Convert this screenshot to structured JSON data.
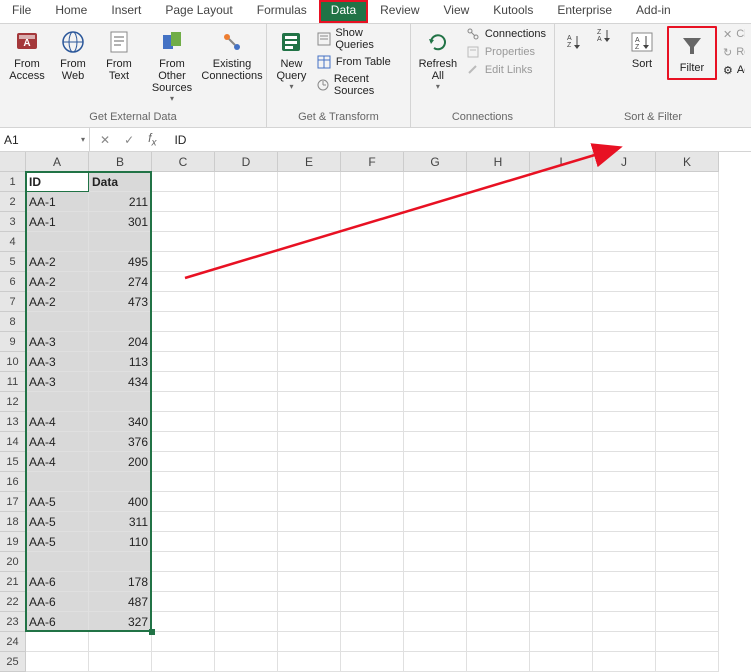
{
  "tabs": {
    "items": [
      "File",
      "Home",
      "Insert",
      "Page Layout",
      "Formulas",
      "Data",
      "Review",
      "View",
      "Kutools",
      "Enterprise",
      "Add-in"
    ],
    "active": "Data"
  },
  "ribbon": {
    "get_external": {
      "title": "Get External Data",
      "from_access": "From\nAccess",
      "from_web": "From\nWeb",
      "from_text": "From\nText",
      "from_other": "From Other\nSources",
      "existing": "Existing\nConnections"
    },
    "get_transform": {
      "title": "Get & Transform",
      "new_query": "New\nQuery",
      "show_queries": "Show Queries",
      "from_table": "From Table",
      "recent": "Recent Sources"
    },
    "connections": {
      "title": "Connections",
      "refresh": "Refresh\nAll",
      "conns": "Connections",
      "props": "Properties",
      "edit_links": "Edit Links"
    },
    "sort_filter": {
      "title": "Sort & Filter",
      "sort": "Sort",
      "filter": "Filter",
      "clear": "Cle",
      "reapply": "Rea",
      "advanced": "Ad"
    }
  },
  "formula_bar": {
    "name": "A1",
    "value": "ID"
  },
  "columns": [
    "A",
    "B",
    "C",
    "D",
    "E",
    "F",
    "G",
    "H",
    "I",
    "J",
    "K"
  ],
  "rows": 25,
  "selection": {
    "c1": 0,
    "r1": 0,
    "c2": 1,
    "r2": 22
  },
  "cells": [
    {
      "r": 0,
      "c": 0,
      "v": "ID",
      "bold": true
    },
    {
      "r": 0,
      "c": 1,
      "v": "Data",
      "bold": true
    },
    {
      "r": 1,
      "c": 0,
      "v": "AA-1"
    },
    {
      "r": 1,
      "c": 1,
      "v": "211",
      "num": true
    },
    {
      "r": 2,
      "c": 0,
      "v": "AA-1"
    },
    {
      "r": 2,
      "c": 1,
      "v": "301",
      "num": true
    },
    {
      "r": 4,
      "c": 0,
      "v": "AA-2"
    },
    {
      "r": 4,
      "c": 1,
      "v": "495",
      "num": true
    },
    {
      "r": 5,
      "c": 0,
      "v": "AA-2"
    },
    {
      "r": 5,
      "c": 1,
      "v": "274",
      "num": true
    },
    {
      "r": 6,
      "c": 0,
      "v": "AA-2"
    },
    {
      "r": 6,
      "c": 1,
      "v": "473",
      "num": true
    },
    {
      "r": 8,
      "c": 0,
      "v": "AA-3"
    },
    {
      "r": 8,
      "c": 1,
      "v": "204",
      "num": true
    },
    {
      "r": 9,
      "c": 0,
      "v": "AA-3"
    },
    {
      "r": 9,
      "c": 1,
      "v": "113",
      "num": true
    },
    {
      "r": 10,
      "c": 0,
      "v": "AA-3"
    },
    {
      "r": 10,
      "c": 1,
      "v": "434",
      "num": true
    },
    {
      "r": 12,
      "c": 0,
      "v": "AA-4"
    },
    {
      "r": 12,
      "c": 1,
      "v": "340",
      "num": true
    },
    {
      "r": 13,
      "c": 0,
      "v": "AA-4"
    },
    {
      "r": 13,
      "c": 1,
      "v": "376",
      "num": true
    },
    {
      "r": 14,
      "c": 0,
      "v": "AA-4"
    },
    {
      "r": 14,
      "c": 1,
      "v": "200",
      "num": true
    },
    {
      "r": 16,
      "c": 0,
      "v": "AA-5"
    },
    {
      "r": 16,
      "c": 1,
      "v": "400",
      "num": true
    },
    {
      "r": 17,
      "c": 0,
      "v": "AA-5"
    },
    {
      "r": 17,
      "c": 1,
      "v": "311",
      "num": true
    },
    {
      "r": 18,
      "c": 0,
      "v": "AA-5"
    },
    {
      "r": 18,
      "c": 1,
      "v": "110",
      "num": true
    },
    {
      "r": 20,
      "c": 0,
      "v": "AA-6"
    },
    {
      "r": 20,
      "c": 1,
      "v": "178",
      "num": true
    },
    {
      "r": 21,
      "c": 0,
      "v": "AA-6"
    },
    {
      "r": 21,
      "c": 1,
      "v": "487",
      "num": true
    },
    {
      "r": 22,
      "c": 0,
      "v": "AA-6"
    },
    {
      "r": 22,
      "c": 1,
      "v": "327",
      "num": true
    }
  ]
}
